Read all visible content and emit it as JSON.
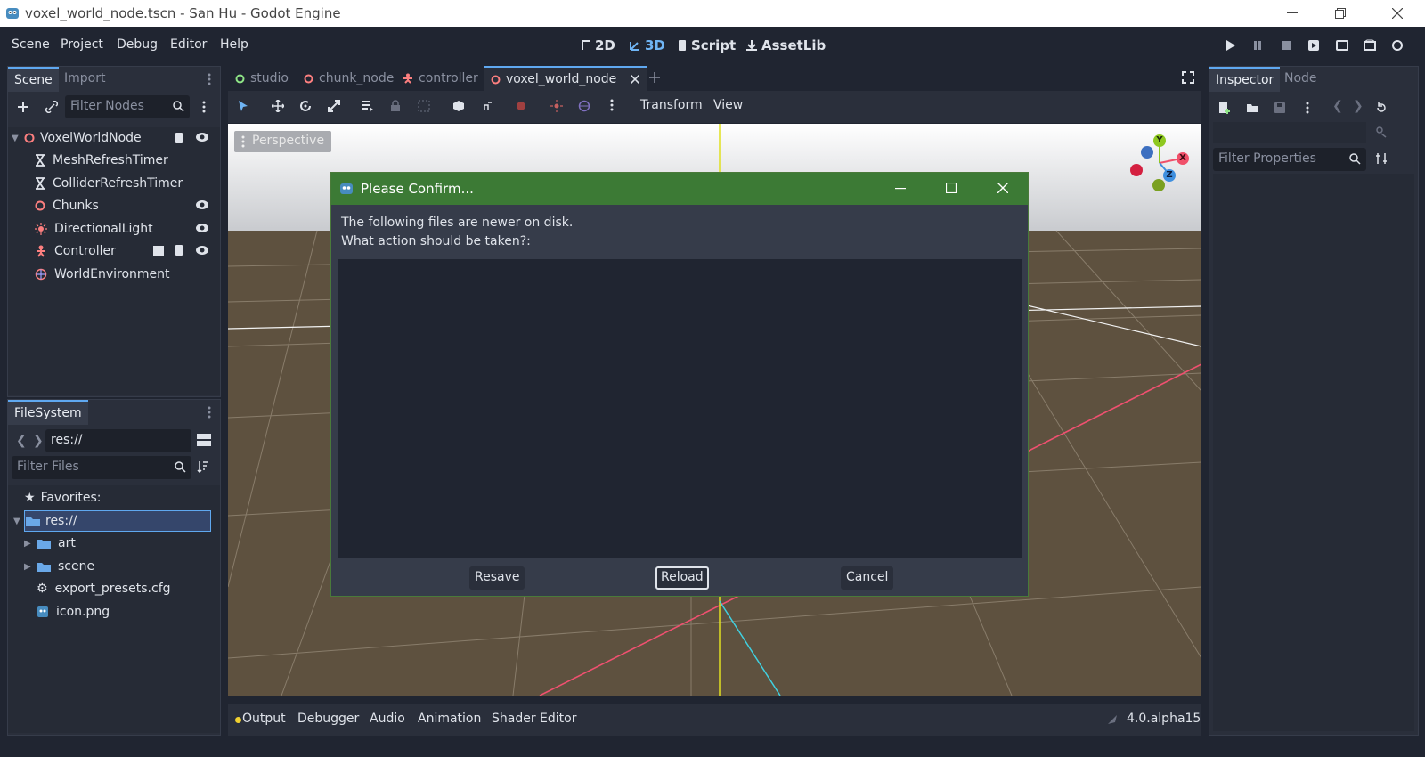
{
  "window": {
    "title": "voxel_world_node.tscn - San Hu - Godot Engine"
  },
  "menu": [
    "Scene",
    "Project",
    "Debug",
    "Editor",
    "Help"
  ],
  "modes": {
    "d2": "2D",
    "d3": "3D",
    "script": "Script",
    "assetlib": "AssetLib"
  },
  "scene_dock": {
    "tabs": [
      "Scene",
      "Import"
    ],
    "filter_placeholder": "Filter Nodes",
    "nodes": [
      {
        "label": "VoxelWorldNode",
        "icon": "node3d-icon"
      },
      {
        "label": "MeshRefreshTimer",
        "icon": "timer-icon"
      },
      {
        "label": "ColliderRefreshTimer",
        "icon": "timer-icon"
      },
      {
        "label": "Chunks",
        "icon": "node3d-icon"
      },
      {
        "label": "DirectionalLight",
        "icon": "light-icon"
      },
      {
        "label": "Controller",
        "icon": "character-icon"
      },
      {
        "label": "WorldEnvironment",
        "icon": "environment-icon"
      }
    ]
  },
  "filesystem_dock": {
    "tab": "FileSystem",
    "path": "res://",
    "filter_placeholder": "Filter Files",
    "favorites": "Favorites:",
    "items": [
      "res://",
      "art",
      "scene",
      "export_presets.cfg",
      "icon.png"
    ]
  },
  "scene_tabs": [
    "studio",
    "chunk_node",
    "controller",
    "voxel_world_node"
  ],
  "viewport": {
    "toolbar": {
      "transform": "Transform",
      "view": "View"
    },
    "perspective": "Perspective",
    "gizmo": {
      "x": "X",
      "y": "Y",
      "z": "Z"
    }
  },
  "dialog": {
    "title": "Please Confirm...",
    "line1": "The following files are newer on disk.",
    "line2": "What action should be taken?:",
    "buttons": {
      "resave": "Resave",
      "reload": "Reload",
      "cancel": "Cancel"
    }
  },
  "inspector": {
    "tabs": [
      "Inspector",
      "Node"
    ],
    "filter_placeholder": "Filter Properties"
  },
  "bottom": {
    "tabs": [
      "Output",
      "Debugger",
      "Audio",
      "Animation",
      "Shader Editor"
    ],
    "version": "4.0.alpha15"
  },
  "colors": {
    "accent": "#5fa8f0",
    "dialog_title": "#3c7a35",
    "node_red": "#fc7f7f"
  }
}
